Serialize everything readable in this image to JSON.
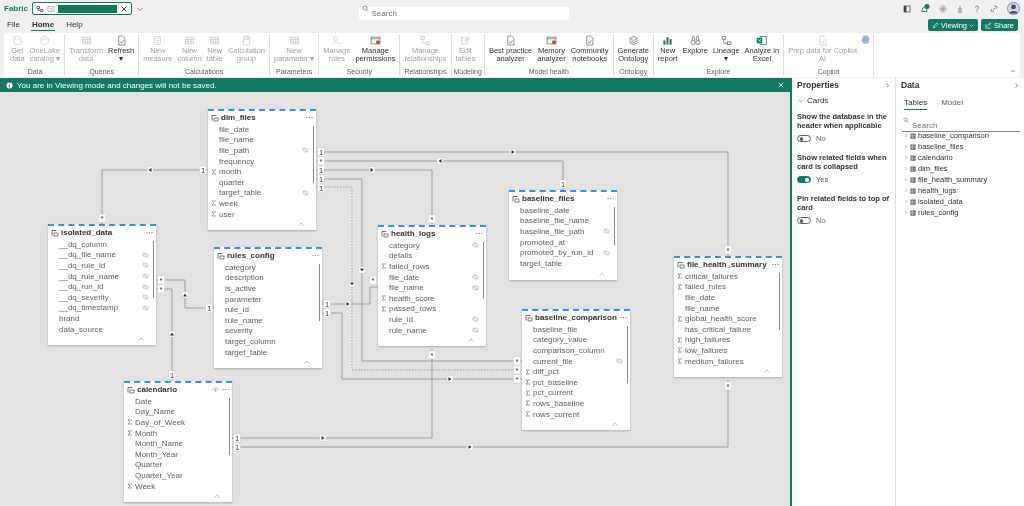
{
  "app": {
    "name": "Fabric",
    "search_placeholder": "Search"
  },
  "menu_tabs": [
    {
      "label": "File",
      "selected": false
    },
    {
      "label": "Home",
      "selected": true
    },
    {
      "label": "Help",
      "selected": false
    }
  ],
  "actions": [
    {
      "label": "Viewing",
      "kind": "dropdown"
    },
    {
      "label": "Share",
      "kind": "share"
    }
  ],
  "ribbon": {
    "groups": [
      {
        "label": "Data",
        "buttons": [
          {
            "label": "Get\ndata",
            "disabled": true
          },
          {
            "label": "OneLake\ncatalog ▾",
            "disabled": true
          }
        ]
      },
      {
        "label": "Queries",
        "buttons": [
          {
            "label": "Transform\ndata",
            "disabled": true
          },
          {
            "label": "Refresh\n▾",
            "disabled": false
          }
        ]
      },
      {
        "label": "Calculations",
        "buttons": [
          {
            "label": "New\nmeasure",
            "disabled": true
          },
          {
            "label": "New\ncolumn",
            "disabled": true
          },
          {
            "label": "New\ntable",
            "disabled": true
          },
          {
            "label": "Calculation\ngroup",
            "disabled": true
          }
        ]
      },
      {
        "label": "Parameters",
        "buttons": [
          {
            "label": "New\nparameter ▾",
            "disabled": true
          }
        ]
      },
      {
        "label": "Security",
        "buttons": [
          {
            "label": "Manage\nroles",
            "disabled": true
          },
          {
            "label": "Manage\npermissions",
            "disabled": false
          }
        ]
      },
      {
        "label": "Relationships",
        "buttons": [
          {
            "label": "Manage\nrelationships",
            "disabled": true
          }
        ]
      },
      {
        "label": "Modeling",
        "buttons": [
          {
            "label": "Edit\ntables",
            "disabled": true
          }
        ]
      },
      {
        "label": "Model health",
        "buttons": [
          {
            "label": "Best practice\nanalyzer",
            "disabled": false
          },
          {
            "label": "Memory\nanalyzer",
            "disabled": false
          },
          {
            "label": "Community\nnotebooks",
            "disabled": false
          }
        ]
      },
      {
        "label": "Ontology",
        "buttons": [
          {
            "label": "Generate\nOntology",
            "disabled": false
          }
        ]
      },
      {
        "label": "Explore",
        "buttons": [
          {
            "label": "New\nreport",
            "disabled": false
          },
          {
            "label": "Explore",
            "disabled": false
          },
          {
            "label": "Lineage\n▾",
            "disabled": false
          },
          {
            "label": "Analyze in\nExcel",
            "disabled": false
          }
        ]
      },
      {
        "label": "Copilot",
        "buttons": [
          {
            "label": "Prep data for Copilot\nAI",
            "disabled": true
          }
        ]
      }
    ]
  },
  "banner": {
    "message": "You are in Viewing mode and changes will not be saved."
  },
  "diagram": {
    "tables": [
      {
        "name": "dim_files",
        "hidden": false,
        "fields": [
          {
            "name": "file_date",
            "kind": "text",
            "hidden": false
          },
          {
            "name": "file_name",
            "kind": "text",
            "hidden": false
          },
          {
            "name": "file_path",
            "kind": "text",
            "hidden": true
          },
          {
            "name": "frequency",
            "kind": "text",
            "hidden": false
          },
          {
            "name": "month",
            "kind": "sum",
            "hidden": false
          },
          {
            "name": "quarter",
            "kind": "text",
            "hidden": false
          },
          {
            "name": "target_table",
            "kind": "text",
            "hidden": true
          },
          {
            "name": "week",
            "kind": "sum",
            "hidden": false
          },
          {
            "name": "user",
            "kind": "sum",
            "hidden": false
          }
        ]
      },
      {
        "name": "isolated_data",
        "hidden": false,
        "fields": [
          {
            "name": "__dq_column",
            "kind": "text",
            "hidden": false
          },
          {
            "name": "__dq_file_name",
            "kind": "text",
            "hidden": true
          },
          {
            "name": "__dq_rule_id",
            "kind": "text",
            "hidden": true
          },
          {
            "name": "__dq_rule_name",
            "kind": "text",
            "hidden": true
          },
          {
            "name": "__dq_run_id",
            "kind": "text",
            "hidden": true
          },
          {
            "name": "__dq_severity",
            "kind": "text",
            "hidden": true
          },
          {
            "name": "__dq_timestamp",
            "kind": "text",
            "hidden": true
          },
          {
            "name": "brand",
            "kind": "text",
            "hidden": false
          },
          {
            "name": "data_source",
            "kind": "text",
            "hidden": false
          }
        ]
      },
      {
        "name": "rules_config",
        "hidden": false,
        "fields": [
          {
            "name": "category",
            "kind": "text",
            "hidden": false
          },
          {
            "name": "description",
            "kind": "text",
            "hidden": false
          },
          {
            "name": "is_active",
            "kind": "text",
            "hidden": false
          },
          {
            "name": "parameter",
            "kind": "text",
            "hidden": false
          },
          {
            "name": "rule_id",
            "kind": "text",
            "hidden": false
          },
          {
            "name": "rule_name",
            "kind": "text",
            "hidden": false
          },
          {
            "name": "severity",
            "kind": "text",
            "hidden": false
          },
          {
            "name": "target_column",
            "kind": "text",
            "hidden": false
          },
          {
            "name": "target_table",
            "kind": "text",
            "hidden": false
          }
        ]
      },
      {
        "name": "calendario",
        "hidden": true,
        "fields": [
          {
            "name": "Date",
            "kind": "text",
            "hidden": false
          },
          {
            "name": "Day_Name",
            "kind": "text",
            "hidden": false
          },
          {
            "name": "Day_of_Week",
            "kind": "sum",
            "hidden": false
          },
          {
            "name": "Month",
            "kind": "sum",
            "hidden": false
          },
          {
            "name": "Month_Name",
            "kind": "text",
            "hidden": false
          },
          {
            "name": "Month_Year",
            "kind": "text",
            "hidden": false
          },
          {
            "name": "Quarter",
            "kind": "text",
            "hidden": false
          },
          {
            "name": "Quarter_Year",
            "kind": "text",
            "hidden": false
          },
          {
            "name": "Week",
            "kind": "sum",
            "hidden": false
          }
        ]
      },
      {
        "name": "health_logs",
        "hidden": false,
        "fields": [
          {
            "name": "category",
            "kind": "text",
            "hidden": true
          },
          {
            "name": "details",
            "kind": "text",
            "hidden": false
          },
          {
            "name": "failed_rows",
            "kind": "sum",
            "hidden": false
          },
          {
            "name": "file_date",
            "kind": "text",
            "hidden": true
          },
          {
            "name": "file_name",
            "kind": "text",
            "hidden": true
          },
          {
            "name": "health_score",
            "kind": "sum",
            "hidden": false
          },
          {
            "name": "passed_rows",
            "kind": "sum",
            "hidden": false
          },
          {
            "name": "rule_id",
            "kind": "text",
            "hidden": true
          },
          {
            "name": "rule_name",
            "kind": "text",
            "hidden": true
          }
        ]
      },
      {
        "name": "baseline_files",
        "hidden": false,
        "fields": [
          {
            "name": "baseline_date",
            "kind": "text",
            "hidden": false
          },
          {
            "name": "baseline_file_name",
            "kind": "text",
            "hidden": false
          },
          {
            "name": "baseline_file_path",
            "kind": "text",
            "hidden": true
          },
          {
            "name": "promoted_at",
            "kind": "text",
            "hidden": false
          },
          {
            "name": "promoted_by_run_id",
            "kind": "text",
            "hidden": true
          },
          {
            "name": "target_table",
            "kind": "text",
            "hidden": false
          }
        ]
      },
      {
        "name": "baseline_comparison",
        "hidden": false,
        "fields": [
          {
            "name": "baseline_file",
            "kind": "text",
            "hidden": false
          },
          {
            "name": "category_value",
            "kind": "text",
            "hidden": false
          },
          {
            "name": "comparison_column",
            "kind": "text",
            "hidden": false
          },
          {
            "name": "current_file",
            "kind": "text",
            "hidden": true
          },
          {
            "name": "diff_pct",
            "kind": "sum",
            "hidden": false
          },
          {
            "name": "pct_baseline",
            "kind": "sum",
            "hidden": false
          },
          {
            "name": "pct_current",
            "kind": "sum",
            "hidden": false
          },
          {
            "name": "rows_baseline",
            "kind": "sum",
            "hidden": false
          },
          {
            "name": "rows_current",
            "kind": "sum",
            "hidden": false
          }
        ]
      },
      {
        "name": "file_health_summary",
        "hidden": false,
        "fields": [
          {
            "name": "critical_failures",
            "kind": "sum",
            "hidden": false
          },
          {
            "name": "failed_rules",
            "kind": "sum",
            "hidden": false
          },
          {
            "name": "file_date",
            "kind": "text",
            "hidden": false
          },
          {
            "name": "file_name",
            "kind": "text",
            "hidden": false
          },
          {
            "name": "global_health_score",
            "kind": "sum",
            "hidden": false
          },
          {
            "name": "has_critical_failure",
            "kind": "text",
            "hidden": false
          },
          {
            "name": "high_failures",
            "kind": "sum",
            "hidden": false
          },
          {
            "name": "low_failures",
            "kind": "sum",
            "hidden": false
          },
          {
            "name": "medium_failures",
            "kind": "sum",
            "hidden": false
          }
        ]
      }
    ],
    "relationships": [
      {
        "start_label": "*",
        "end_label": "1",
        "active": true
      },
      {
        "start_label": "1",
        "end_label": "*",
        "active": true
      },
      {
        "start_label": "*",
        "end_label": "1",
        "active": true
      },
      {
        "start_label": "1",
        "end_label": "*",
        "active": true
      },
      {
        "start_label": "1",
        "end_label": "*",
        "active": true
      },
      {
        "start_label": "1",
        "end_label": "*",
        "active": false
      },
      {
        "start_label": "1",
        "end_label": "*",
        "active": true
      },
      {
        "start_label": "1",
        "end_label": "*",
        "active": true
      },
      {
        "start_label": "*",
        "end_label": "1",
        "active": true
      },
      {
        "start_label": "*",
        "end_label": "1",
        "active": true
      },
      {
        "start_label": "1",
        "end_label": "*",
        "active": true
      },
      {
        "start_label": "1",
        "end_label": "*",
        "active": true
      }
    ]
  },
  "properties": {
    "title": "Properties",
    "section": "Cards",
    "settings": [
      {
        "label": "Show the database in the header when applicable",
        "on": false,
        "value": "No"
      },
      {
        "label": "Show related fields when card is collapsed",
        "on": true,
        "value": "Yes"
      },
      {
        "label": "Pin related fields to top of card",
        "on": false,
        "value": "No"
      }
    ]
  },
  "data_pane": {
    "title": "Data",
    "tabs": [
      {
        "label": "Tables",
        "selected": true
      },
      {
        "label": "Model",
        "selected": false
      }
    ],
    "search_placeholder": "Search",
    "tables": [
      {
        "name": "baseline_comparison",
        "expanded": false
      },
      {
        "name": "baseline_files",
        "expanded": false
      },
      {
        "name": "calendario",
        "expanded": false
      },
      {
        "name": "dim_files",
        "expanded": false
      },
      {
        "name": "file_health_summary",
        "expanded": false
      },
      {
        "name": "health_logs",
        "expanded": false
      },
      {
        "name": "isolated_data",
        "expanded": false
      },
      {
        "name": "rules_config",
        "expanded": false
      }
    ]
  }
}
